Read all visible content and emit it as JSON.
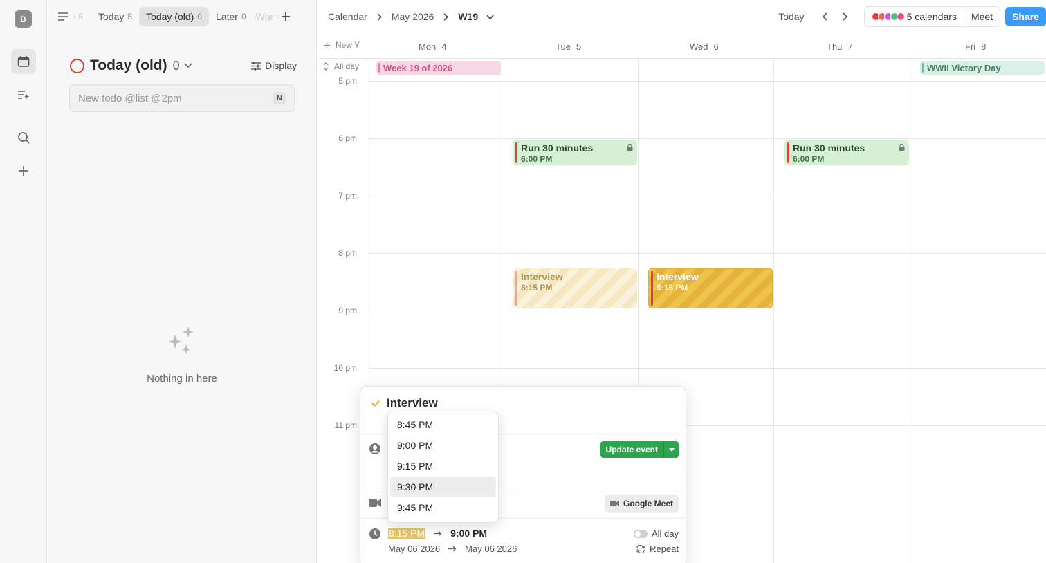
{
  "rail": {
    "avatar_letter": "B"
  },
  "sidebar": {
    "tab_prev": "‹ 5",
    "tabs": [
      {
        "label": "Today",
        "count": "5"
      },
      {
        "label": "Today (old)",
        "count": "0"
      },
      {
        "label": "Later",
        "count": "0"
      }
    ],
    "tab_faded": "Wor",
    "list_title": "Today (old)",
    "list_count": "0",
    "display_label": "Display",
    "todo_placeholder": "New todo @list @2pm",
    "todo_shortcut": "N",
    "empty_text": "Nothing in here"
  },
  "topbar": {
    "crumbs": [
      "Calendar",
      "May 2026",
      "W19"
    ],
    "today_label": "Today",
    "calendars_label": "5 calendars",
    "meet_label": "Meet",
    "share_label": "Share",
    "calendar_colors": [
      "#e0413a",
      "#e86a5c",
      "#c65adf",
      "#4fc283",
      "#ec4e88"
    ]
  },
  "grid": {
    "new_label": "New Y",
    "allday_label": "All day",
    "days": [
      {
        "name": "Mon",
        "num": "4"
      },
      {
        "name": "Tue",
        "num": "5"
      },
      {
        "name": "Wed",
        "num": "6"
      },
      {
        "name": "Thu",
        "num": "7"
      },
      {
        "name": "Fri",
        "num": "8"
      }
    ],
    "hours": [
      "5 pm",
      "6 pm",
      "7 pm",
      "8 pm",
      "9 pm",
      "10 pm",
      "11 pm"
    ],
    "allday_events": [
      {
        "title": "Week 19 of 2026",
        "color": "#f7d9e6",
        "bar": "#ec7aa8",
        "text": "#c05a82"
      },
      {
        "title": "WWII Victory Day",
        "color": "#dbf1e7",
        "bar": "#5ec39a",
        "text": "#4e7a66"
      }
    ],
    "events": [
      {
        "title": "Run 30 minutes",
        "time": "6:00 PM"
      },
      {
        "title": "Run 30 minutes",
        "time": "6:00 PM"
      },
      {
        "title": "Interview",
        "time": "8:15 PM"
      },
      {
        "title": "Interview",
        "time": "8:15 PM"
      }
    ]
  },
  "popover": {
    "title": "Interview",
    "update_label": "Update event",
    "meet_label": "Google Meet",
    "start_time": "8:15 PM",
    "end_time": "9:00 PM",
    "start_date": "May 06 2026",
    "end_date": "May 06 2026",
    "allday_label": "All day",
    "repeat_label": "Repeat"
  },
  "dropdown": {
    "options": [
      "8:45 PM",
      "9:00 PM",
      "9:15 PM",
      "9:30 PM",
      "9:45 PM"
    ],
    "highlighted": "9:30 PM"
  }
}
